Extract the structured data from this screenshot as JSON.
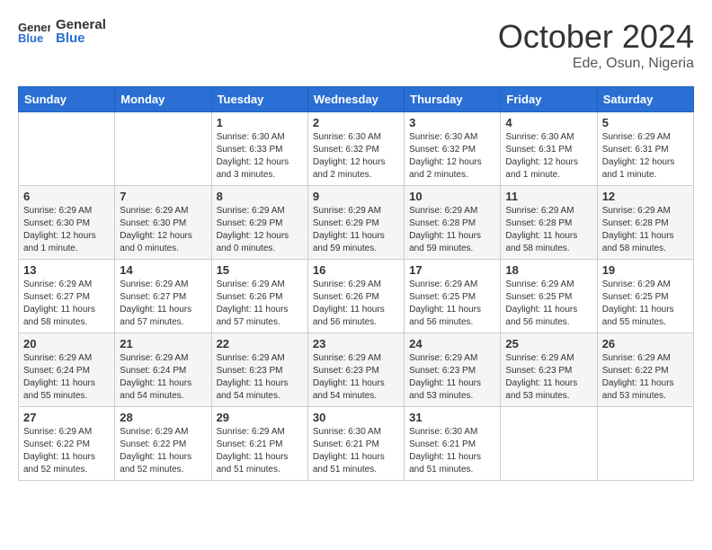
{
  "header": {
    "logo_general": "General",
    "logo_blue": "Blue",
    "month": "October 2024",
    "location": "Ede, Osun, Nigeria"
  },
  "days_of_week": [
    "Sunday",
    "Monday",
    "Tuesday",
    "Wednesday",
    "Thursday",
    "Friday",
    "Saturday"
  ],
  "weeks": [
    [
      {
        "day": "",
        "info": ""
      },
      {
        "day": "",
        "info": ""
      },
      {
        "day": "1",
        "info": "Sunrise: 6:30 AM\nSunset: 6:33 PM\nDaylight: 12 hours and 3 minutes."
      },
      {
        "day": "2",
        "info": "Sunrise: 6:30 AM\nSunset: 6:32 PM\nDaylight: 12 hours and 2 minutes."
      },
      {
        "day": "3",
        "info": "Sunrise: 6:30 AM\nSunset: 6:32 PM\nDaylight: 12 hours and 2 minutes."
      },
      {
        "day": "4",
        "info": "Sunrise: 6:30 AM\nSunset: 6:31 PM\nDaylight: 12 hours and 1 minute."
      },
      {
        "day": "5",
        "info": "Sunrise: 6:29 AM\nSunset: 6:31 PM\nDaylight: 12 hours and 1 minute."
      }
    ],
    [
      {
        "day": "6",
        "info": "Sunrise: 6:29 AM\nSunset: 6:30 PM\nDaylight: 12 hours and 1 minute."
      },
      {
        "day": "7",
        "info": "Sunrise: 6:29 AM\nSunset: 6:30 PM\nDaylight: 12 hours and 0 minutes."
      },
      {
        "day": "8",
        "info": "Sunrise: 6:29 AM\nSunset: 6:29 PM\nDaylight: 12 hours and 0 minutes."
      },
      {
        "day": "9",
        "info": "Sunrise: 6:29 AM\nSunset: 6:29 PM\nDaylight: 11 hours and 59 minutes."
      },
      {
        "day": "10",
        "info": "Sunrise: 6:29 AM\nSunset: 6:28 PM\nDaylight: 11 hours and 59 minutes."
      },
      {
        "day": "11",
        "info": "Sunrise: 6:29 AM\nSunset: 6:28 PM\nDaylight: 11 hours and 58 minutes."
      },
      {
        "day": "12",
        "info": "Sunrise: 6:29 AM\nSunset: 6:28 PM\nDaylight: 11 hours and 58 minutes."
      }
    ],
    [
      {
        "day": "13",
        "info": "Sunrise: 6:29 AM\nSunset: 6:27 PM\nDaylight: 11 hours and 58 minutes."
      },
      {
        "day": "14",
        "info": "Sunrise: 6:29 AM\nSunset: 6:27 PM\nDaylight: 11 hours and 57 minutes."
      },
      {
        "day": "15",
        "info": "Sunrise: 6:29 AM\nSunset: 6:26 PM\nDaylight: 11 hours and 57 minutes."
      },
      {
        "day": "16",
        "info": "Sunrise: 6:29 AM\nSunset: 6:26 PM\nDaylight: 11 hours and 56 minutes."
      },
      {
        "day": "17",
        "info": "Sunrise: 6:29 AM\nSunset: 6:25 PM\nDaylight: 11 hours and 56 minutes."
      },
      {
        "day": "18",
        "info": "Sunrise: 6:29 AM\nSunset: 6:25 PM\nDaylight: 11 hours and 56 minutes."
      },
      {
        "day": "19",
        "info": "Sunrise: 6:29 AM\nSunset: 6:25 PM\nDaylight: 11 hours and 55 minutes."
      }
    ],
    [
      {
        "day": "20",
        "info": "Sunrise: 6:29 AM\nSunset: 6:24 PM\nDaylight: 11 hours and 55 minutes."
      },
      {
        "day": "21",
        "info": "Sunrise: 6:29 AM\nSunset: 6:24 PM\nDaylight: 11 hours and 54 minutes."
      },
      {
        "day": "22",
        "info": "Sunrise: 6:29 AM\nSunset: 6:23 PM\nDaylight: 11 hours and 54 minutes."
      },
      {
        "day": "23",
        "info": "Sunrise: 6:29 AM\nSunset: 6:23 PM\nDaylight: 11 hours and 54 minutes."
      },
      {
        "day": "24",
        "info": "Sunrise: 6:29 AM\nSunset: 6:23 PM\nDaylight: 11 hours and 53 minutes."
      },
      {
        "day": "25",
        "info": "Sunrise: 6:29 AM\nSunset: 6:23 PM\nDaylight: 11 hours and 53 minutes."
      },
      {
        "day": "26",
        "info": "Sunrise: 6:29 AM\nSunset: 6:22 PM\nDaylight: 11 hours and 53 minutes."
      }
    ],
    [
      {
        "day": "27",
        "info": "Sunrise: 6:29 AM\nSunset: 6:22 PM\nDaylight: 11 hours and 52 minutes."
      },
      {
        "day": "28",
        "info": "Sunrise: 6:29 AM\nSunset: 6:22 PM\nDaylight: 11 hours and 52 minutes."
      },
      {
        "day": "29",
        "info": "Sunrise: 6:29 AM\nSunset: 6:21 PM\nDaylight: 11 hours and 51 minutes."
      },
      {
        "day": "30",
        "info": "Sunrise: 6:30 AM\nSunset: 6:21 PM\nDaylight: 11 hours and 51 minutes."
      },
      {
        "day": "31",
        "info": "Sunrise: 6:30 AM\nSunset: 6:21 PM\nDaylight: 11 hours and 51 minutes."
      },
      {
        "day": "",
        "info": ""
      },
      {
        "day": "",
        "info": ""
      }
    ]
  ]
}
